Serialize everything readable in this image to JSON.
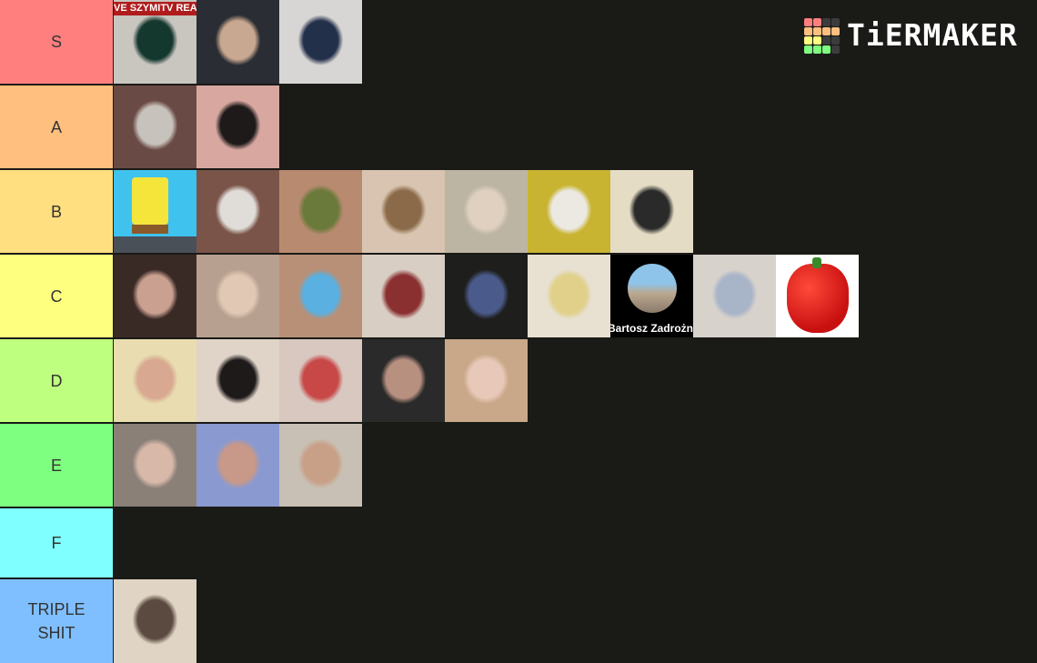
{
  "logo": {
    "text": "TiERMAKER",
    "grid_colors": [
      "#ff7f7f",
      "#ff7f7f",
      "#3c3c3c",
      "#3c3c3c",
      "#ffbf7f",
      "#ffbf7f",
      "#ffbf7f",
      "#ffbf7f",
      "#ffff7f",
      "#ffff7f",
      "#3c3c3c",
      "#3c3c3c",
      "#7fff7f",
      "#7fff7f",
      "#7fff7f",
      "#3c3c3c"
    ]
  },
  "tiers": [
    {
      "label": "S",
      "color": "#ff7f7f",
      "items": [
        {
          "name": "szymitv-reaction-thumbnail",
          "caption": "VE SZYMITV REACTIO",
          "bg": "#c9c5bf",
          "accent": "#14382e"
        },
        {
          "name": "boy-dark-hoodie",
          "bg": "#2a2d33",
          "accent": "#c8a890"
        },
        {
          "name": "boy-grey-hoodie-jacket",
          "bg": "#d8d6d4",
          "accent": "#23304a"
        }
      ]
    },
    {
      "label": "A",
      "color": "#ffbf7f",
      "items": [
        {
          "name": "nostril-closeup",
          "bg": "#6a4a44",
          "accent": "#c8c2bc"
        },
        {
          "name": "surprised-face",
          "bg": "#d8a8a0",
          "accent": "#1e1a1a"
        }
      ]
    },
    {
      "label": "B",
      "color": "#ffdf7f",
      "items": [
        {
          "name": "spongebob",
          "bg": "#3fc3ee",
          "accent": "#f5e43a"
        },
        {
          "name": "eye-closeup",
          "bg": "#7a5448",
          "accent": "#e0dcd8"
        },
        {
          "name": "cannabis-buds",
          "bg": "#b88a70",
          "accent": "#6a7a3a"
        },
        {
          "name": "upside-down-face",
          "bg": "#d8c4b0",
          "accent": "#8a6a48"
        },
        {
          "name": "shaved-head-boy",
          "bg": "#bdb5a4",
          "accent": "#e0d0c0"
        },
        {
          "name": "boy-white-hoodie",
          "bg": "#c8b430",
          "accent": "#ece8e2"
        },
        {
          "name": "boy-glasses-mustache",
          "bg": "#e4dcc4",
          "accent": "#2a2a2a"
        }
      ]
    },
    {
      "label": "C",
      "color": "#ffff7f",
      "items": [
        {
          "name": "girl-dark-hair",
          "bg": "#3a2a26",
          "accent": "#caa090"
        },
        {
          "name": "boy-undercut",
          "bg": "#b8a090",
          "accent": "#e0c8b4"
        },
        {
          "name": "snoop-dogg",
          "bg": "#b89078",
          "accent": "#5ab0e0"
        },
        {
          "name": "cat-filter-face",
          "bg": "#d8cec4",
          "accent": "#8a3030"
        },
        {
          "name": "smurf-figure",
          "bg": "#1e1e1c",
          "accent": "#4a5a8a"
        },
        {
          "name": "scrambled-noodles",
          "bg": "#e8e0d0",
          "accent": "#e0d08a"
        },
        {
          "name": "profile-bartosz",
          "caption": "Bartosz Zadrożn",
          "bg": "#000000",
          "accent": "#3a7ad0"
        },
        {
          "name": "girl-curly-hair",
          "bg": "#d8d2cc",
          "accent": "#a8b4c8"
        },
        {
          "name": "red-bell-pepper",
          "bg": "#ffffff",
          "accent": "#d81818"
        }
      ]
    },
    {
      "label": "D",
      "color": "#bfff7f",
      "items": [
        {
          "name": "boy-blond-closeup",
          "bg": "#e8dcb0",
          "accent": "#d8a890"
        },
        {
          "name": "bald-boy-shouting",
          "bg": "#e0d4c8",
          "accent": "#1e1a1a"
        },
        {
          "name": "boy-red-headphones",
          "bg": "#d8c8c0",
          "accent": "#c84848"
        },
        {
          "name": "boy-dark-room",
          "bg": "#2a2a2a",
          "accent": "#b89080"
        },
        {
          "name": "boy-long-blond-hair",
          "bg": "#c8a888",
          "accent": "#e8c8b8"
        }
      ]
    },
    {
      "label": "E",
      "color": "#7fff7f",
      "items": [
        {
          "name": "boy-brown-hair",
          "bg": "#8a8078",
          "accent": "#d8b8a8"
        },
        {
          "name": "monkey-filter-face",
          "bg": "#8a9ad0",
          "accent": "#c89888"
        },
        {
          "name": "boy-buzzcut",
          "bg": "#c8c0b4",
          "accent": "#c8a088"
        }
      ]
    },
    {
      "label": "F",
      "color": "#7fffff",
      "items": []
    },
    {
      "label": "TRIPLE SHIT",
      "color": "#7fbfff",
      "items": [
        {
          "name": "boy-looking-down",
          "bg": "#e0d4c4",
          "accent": "#5a4a40"
        }
      ]
    }
  ]
}
